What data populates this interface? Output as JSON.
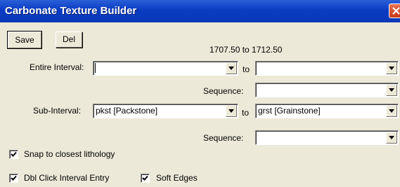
{
  "window": {
    "title": "Carbonate Texture Builder",
    "close_icon": "close-icon"
  },
  "toolbar": {
    "save_label": "Save",
    "del_label": "Del"
  },
  "interval_range": "1707.50 to 1712.50",
  "entire_interval": {
    "label": "Entire Interval:",
    "from_value": "",
    "to_label": "to",
    "to_value": ""
  },
  "sequence_1": {
    "label": "Sequence:",
    "value": ""
  },
  "sub_interval": {
    "label": "Sub-Interval:",
    "from_value": "pkst  [Packstone]",
    "to_label": "to",
    "to_value": "grst  [Grainstone]"
  },
  "sequence_2": {
    "label": "Sequence:",
    "value": ""
  },
  "options": {
    "snap_label": "Snap to closest lithology",
    "snap_checked": true,
    "dbl_click_label": "Dbl Click Interval Entry",
    "dbl_click_checked": true,
    "soft_edges_label": "Soft Edges",
    "soft_edges_checked": true
  },
  "colors": {
    "titlebar": "#0a3cc3",
    "dialog_bg": "#ece9d8",
    "close": "#d24a25"
  }
}
